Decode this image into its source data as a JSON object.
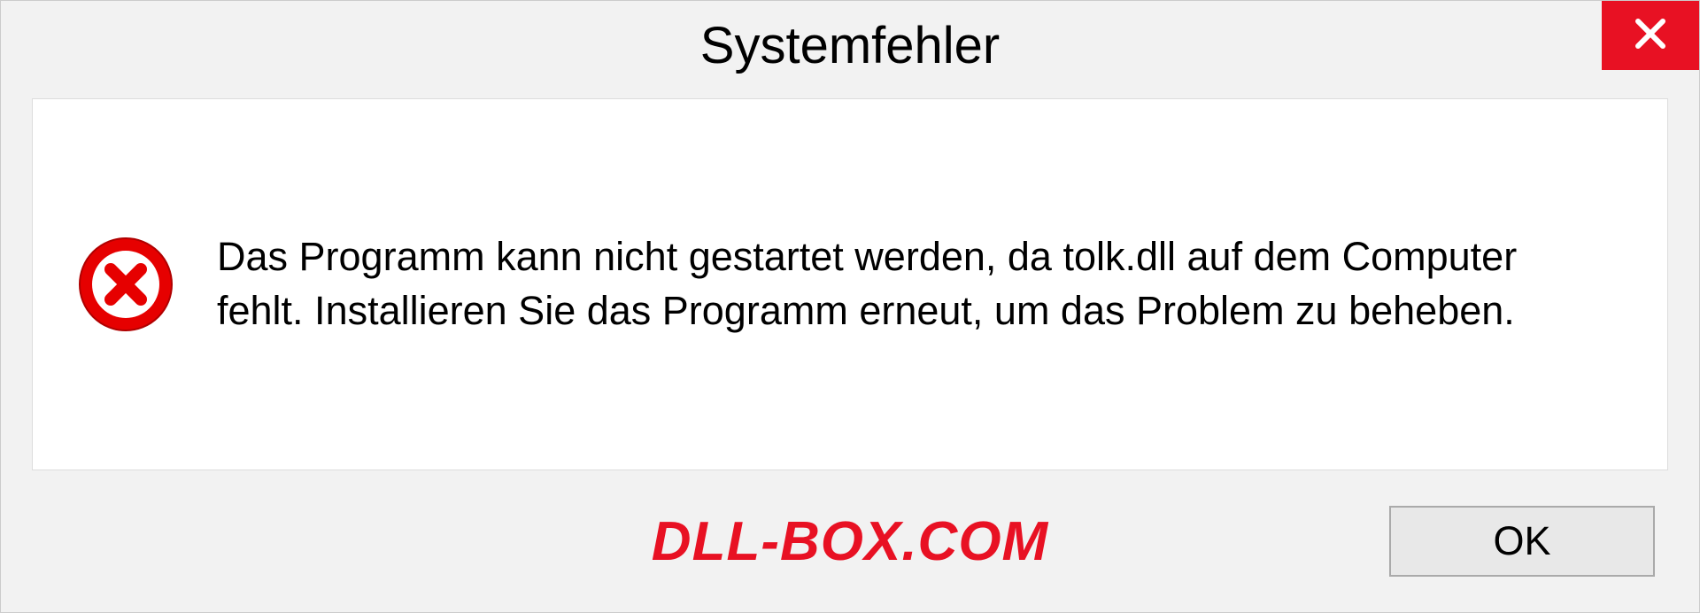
{
  "dialog": {
    "title": "Systemfehler",
    "message": "Das Programm kann nicht gestartet werden, da tolk.dll auf dem Computer fehlt. Installieren Sie das Programm erneut, um das Problem zu beheben.",
    "ok_label": "OK"
  },
  "watermark": "DLL-BOX.COM",
  "colors": {
    "accent_red": "#e81123"
  }
}
